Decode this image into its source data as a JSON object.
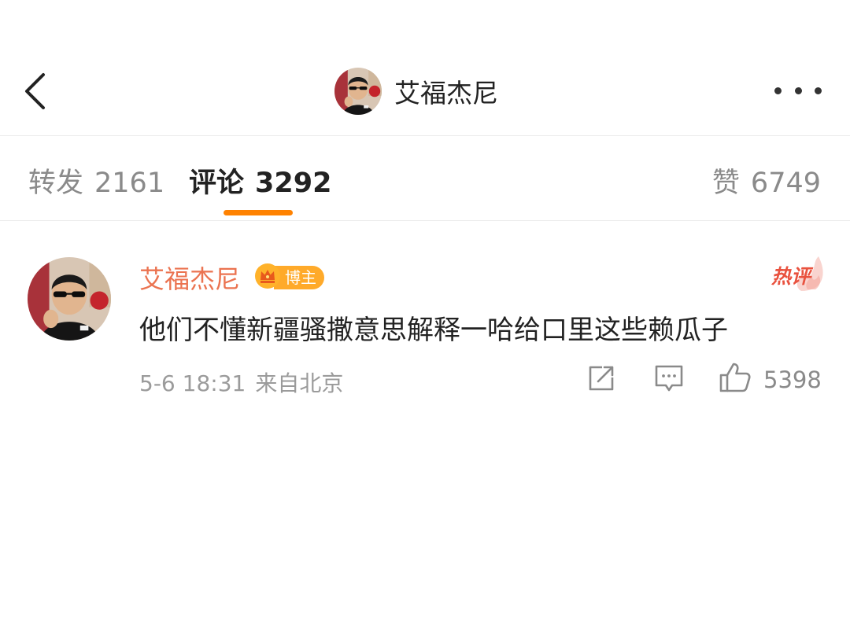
{
  "header": {
    "title": "艾福杰尼",
    "back_icon": "chevron-left-icon",
    "more_icon": "more-horizontal-icon"
  },
  "tabs": {
    "forward": {
      "label": "转发",
      "count": "2161"
    },
    "comment": {
      "label": "评论",
      "count": "3292",
      "active": true
    },
    "like": {
      "label": "赞",
      "count": "6749"
    }
  },
  "comment": {
    "username": "艾福杰尼",
    "badge": "博主",
    "hot_tag": "热评",
    "text": "他们不懂新疆骚撒意思解释一哈给口里这些赖瓜子",
    "date": "5-6 18:31",
    "source": "来自北京",
    "likes": "5398"
  },
  "colors": {
    "accent": "#ff8200",
    "username": "#eb7350",
    "badge": "#ffaa2a",
    "hot": "#e9523f"
  }
}
